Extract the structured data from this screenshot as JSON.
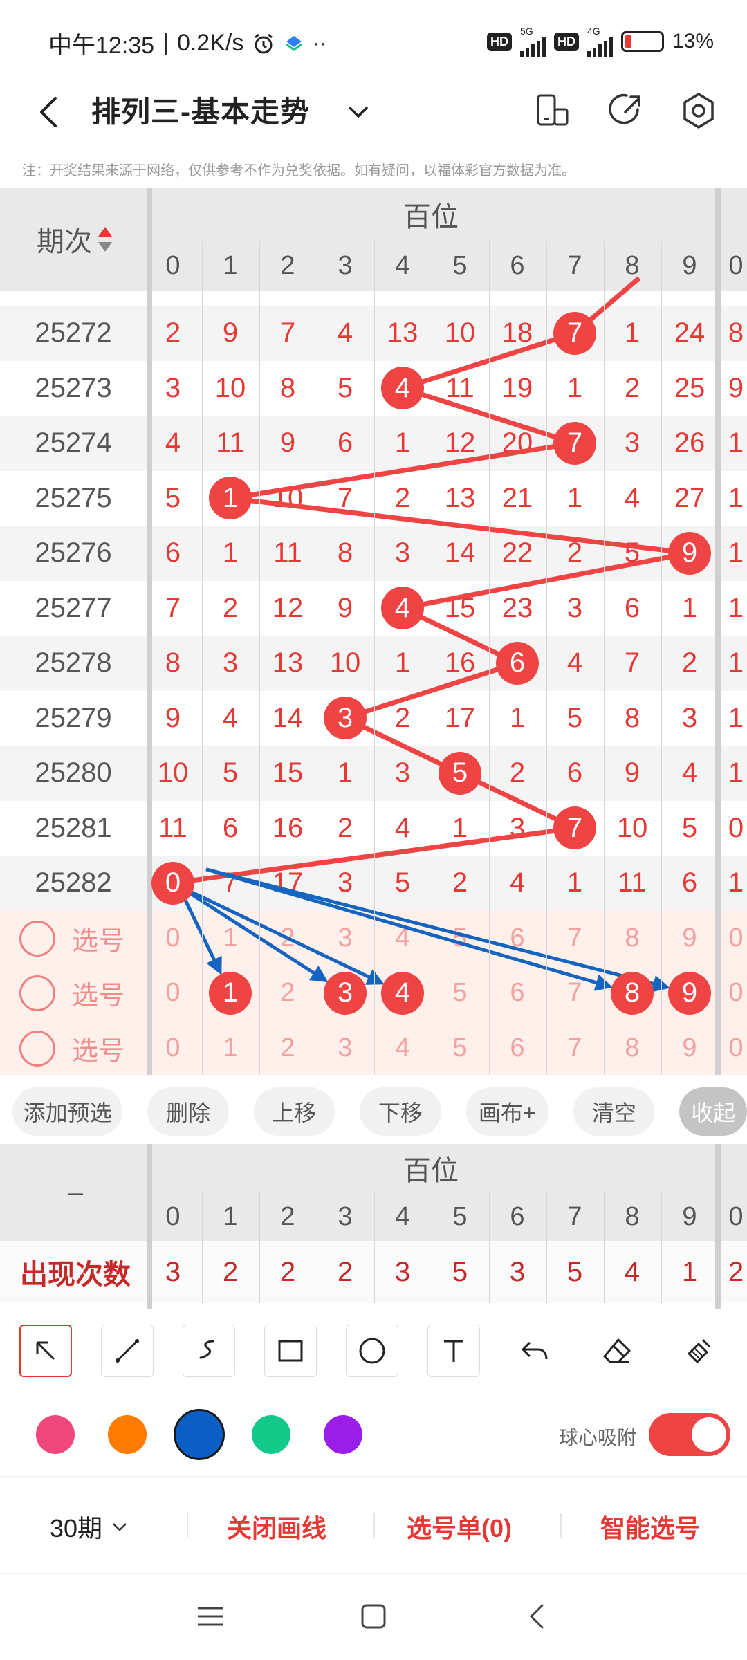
{
  "status": {
    "time": "中午12:35",
    "speed": "0.2K/s",
    "hd1": "HD",
    "net1": "5G",
    "hd2": "HD",
    "net2": "4G",
    "battery": "13%"
  },
  "header": {
    "title": "排列三-基本走势"
  },
  "notice": "注：开奖结果来源于网络，仅供参考不作为兑奖依据。如有疑问，以福体彩官方数据为准。",
  "table": {
    "col_label": "期次",
    "section_label": "百位",
    "digits": [
      "0",
      "1",
      "2",
      "3",
      "4",
      "5",
      "6",
      "7",
      "8",
      "9"
    ],
    "extra_col_digit": "0",
    "rows": [
      {
        "issue": "25272",
        "cells": [
          "2",
          "9",
          "7",
          "4",
          "13",
          "10",
          "18",
          "7",
          "1",
          "24"
        ],
        "hit": 7,
        "extra": "8"
      },
      {
        "issue": "25273",
        "cells": [
          "3",
          "10",
          "8",
          "5",
          "4",
          "11",
          "19",
          "1",
          "2",
          "25"
        ],
        "hit": 4,
        "extra": "9"
      },
      {
        "issue": "25274",
        "cells": [
          "4",
          "11",
          "9",
          "6",
          "1",
          "12",
          "20",
          "7",
          "3",
          "26"
        ],
        "hit": 7,
        "extra": "1"
      },
      {
        "issue": "25275",
        "cells": [
          "5",
          "1",
          "10",
          "7",
          "2",
          "13",
          "21",
          "1",
          "4",
          "27"
        ],
        "hit": 1,
        "extra": "1"
      },
      {
        "issue": "25276",
        "cells": [
          "6",
          "1",
          "11",
          "8",
          "3",
          "14",
          "22",
          "2",
          "5",
          "9"
        ],
        "hit": 9,
        "extra": "1"
      },
      {
        "issue": "25277",
        "cells": [
          "7",
          "2",
          "12",
          "9",
          "4",
          "15",
          "23",
          "3",
          "6",
          "1"
        ],
        "hit": 4,
        "extra": "1"
      },
      {
        "issue": "25278",
        "cells": [
          "8",
          "3",
          "13",
          "10",
          "1",
          "16",
          "6",
          "4",
          "7",
          "2"
        ],
        "hit": 6,
        "extra": "1"
      },
      {
        "issue": "25279",
        "cells": [
          "9",
          "4",
          "14",
          "3",
          "2",
          "17",
          "1",
          "5",
          "8",
          "3"
        ],
        "hit": 3,
        "extra": "1"
      },
      {
        "issue": "25280",
        "cells": [
          "10",
          "5",
          "15",
          "1",
          "3",
          "5",
          "2",
          "6",
          "9",
          "4"
        ],
        "hit": 5,
        "extra": "1"
      },
      {
        "issue": "25281",
        "cells": [
          "11",
          "6",
          "16",
          "2",
          "4",
          "1",
          "3",
          "7",
          "10",
          "5"
        ],
        "hit": 7,
        "extra": "0"
      },
      {
        "issue": "25282",
        "cells": [
          "0",
          "7",
          "17",
          "3",
          "5",
          "2",
          "4",
          "1",
          "11",
          "6"
        ],
        "hit": 0,
        "extra": "1"
      }
    ],
    "pick_label": "选号",
    "picks": [
      {
        "selected": []
      },
      {
        "selected": [
          1,
          3,
          4,
          8,
          9
        ]
      },
      {
        "selected": []
      }
    ]
  },
  "actions": [
    "添加预选",
    "删除",
    "上移",
    "下移",
    "画布+",
    "清空",
    "收起"
  ],
  "stats": {
    "corner": "–",
    "section_label": "百位",
    "row_label": "出现次数",
    "values": [
      "3",
      "2",
      "2",
      "2",
      "3",
      "5",
      "3",
      "5",
      "4",
      "1"
    ],
    "extra": "2"
  },
  "tools": [
    "arrow-tool",
    "line-tool",
    "freehand-tool",
    "rectangle-tool",
    "circle-tool",
    "text-tool",
    "undo-tool",
    "eraser-tool",
    "clear-tool"
  ],
  "colors": {
    "swatches": [
      "#f0477d",
      "#ff7a00",
      "#0b5fc4",
      "#12c98a",
      "#9b1ee8"
    ],
    "selected_index": 2,
    "hit": "#ef4444",
    "arrow": "#1565c0"
  },
  "snap": {
    "label": "球心吸附",
    "on": true
  },
  "bottom": {
    "period": "30期",
    "close_draw": "关闭画线",
    "pick_list": "选号单(0)",
    "smart_pick": "智能选号"
  }
}
